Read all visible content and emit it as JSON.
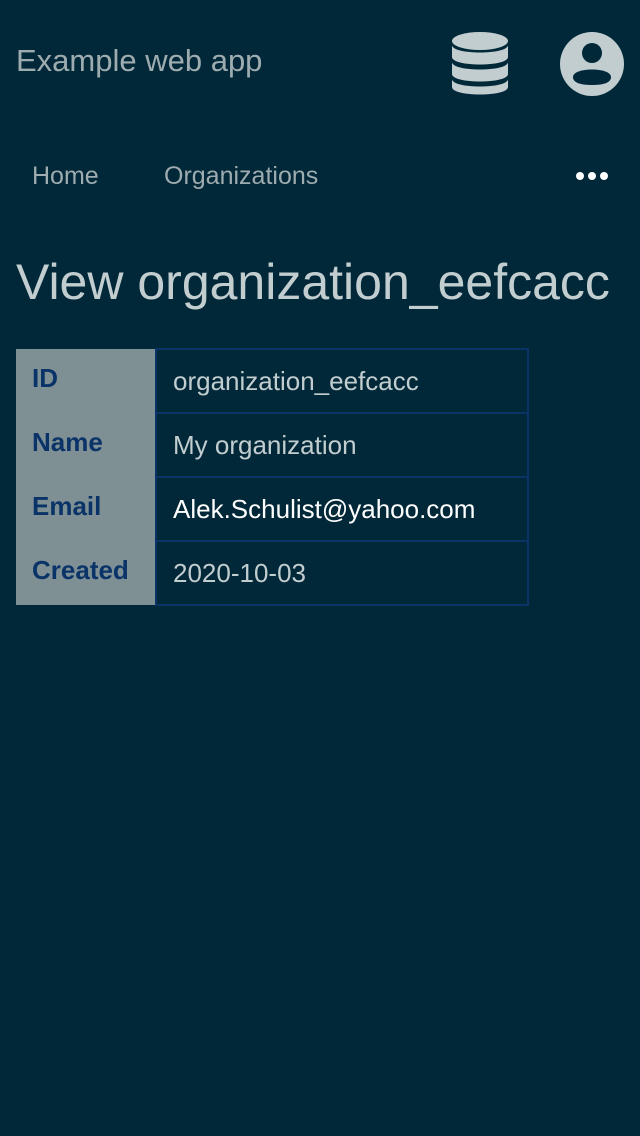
{
  "header": {
    "app_title": "Example web app",
    "icons": [
      "database-icon",
      "user-avatar-icon"
    ]
  },
  "nav": {
    "items": [
      {
        "label": "Home"
      },
      {
        "label": "Organizations"
      }
    ],
    "more_icon": "more-horizontal-icon"
  },
  "page": {
    "title": "View organization_eefcacc"
  },
  "details": {
    "rows": [
      {
        "label": "ID",
        "value": "organization_eefcacc"
      },
      {
        "label": "Name",
        "value": "My organization"
      },
      {
        "label": "Email",
        "value": "Alek.Schulist@yahoo.com"
      },
      {
        "label": "Created",
        "value": "2020-10-03"
      }
    ]
  },
  "colors": {
    "background": "#002838",
    "text": "#c2cdd0",
    "label_cell_bg": "#7f9095",
    "label_text": "#0a3368",
    "border": "#0a3368",
    "icon": "#c2cdd0"
  }
}
